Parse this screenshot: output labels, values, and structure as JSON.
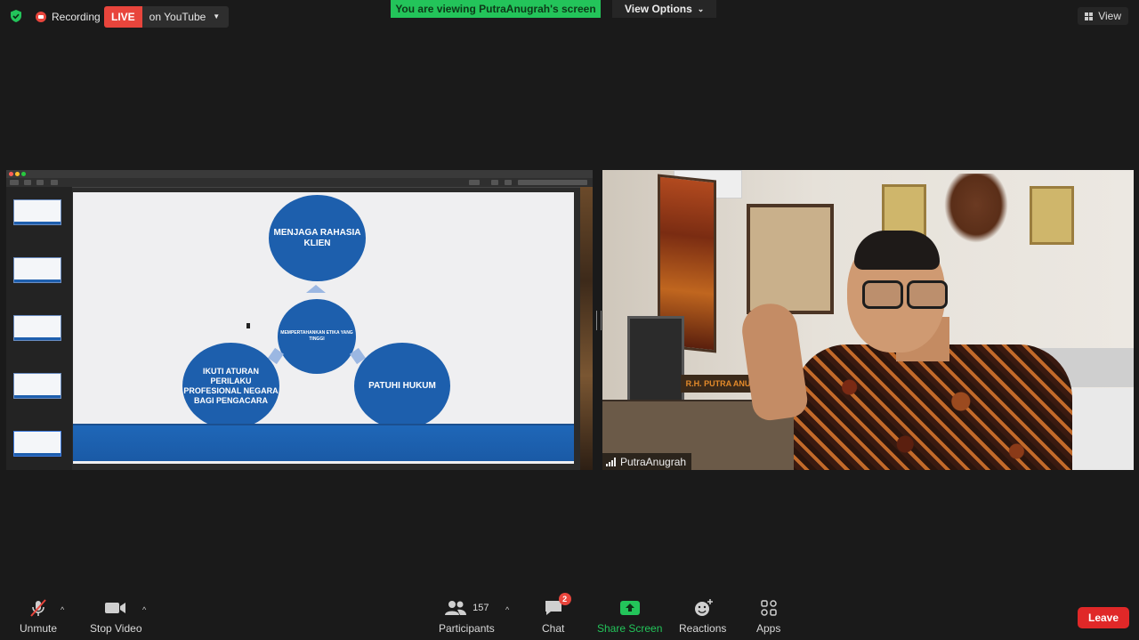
{
  "topbar": {
    "recording_label": "Recording",
    "live_label": "LIVE",
    "live_platform": "on YouTube",
    "banner": "You are viewing PutraAnugrah's screen",
    "view_options": "View Options",
    "view": "View"
  },
  "shared_slide": {
    "top_circle": "MENJAGA RAHASIA KLIEN",
    "center_circle": "MEMPERTAHANKAN ETIKA YANG TINGGI",
    "left_circle": "IKUTI ATURAN PERILAKU PROFESIONAL NEGARA BAGI PENGACARA",
    "right_circle": "PATUHI HUKUM"
  },
  "video": {
    "participant_name": "PutraAnugrah",
    "nameplate": "R.H. PUTRA ANU"
  },
  "toolbar": {
    "unmute": "Unmute",
    "stop_video": "Stop Video",
    "participants": "Participants",
    "participant_count": "157",
    "chat": "Chat",
    "chat_badge": "2",
    "share_screen": "Share Screen",
    "reactions": "Reactions",
    "apps": "Apps",
    "leave": "Leave"
  },
  "colors": {
    "accent_green": "#23c45a",
    "live_red": "#e8453c",
    "leave_red": "#e02828",
    "slide_blue": "#1d5fad"
  }
}
